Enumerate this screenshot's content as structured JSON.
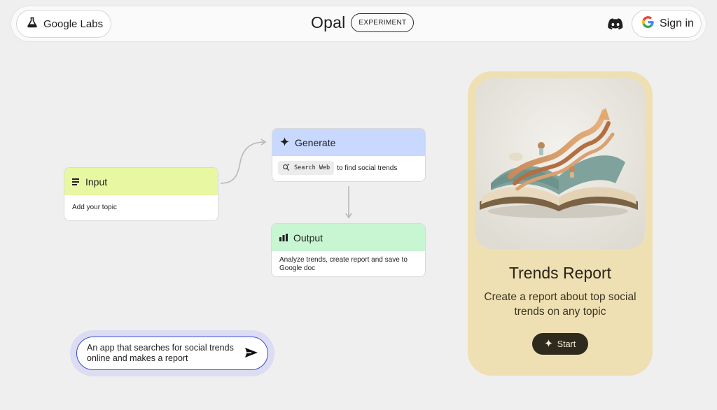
{
  "header": {
    "labs_label": "Google Labs",
    "title": "Opal",
    "badge": "EXPERIMENT",
    "signin_label": "Sign in"
  },
  "icons": {
    "labs": "flask-icon",
    "discord": "discord-icon",
    "signin": "google-g-icon",
    "input": "text-lines-icon",
    "generate": "sparkle-icon",
    "output": "bar-chart-icon",
    "search_chip": "search-sparkle-icon",
    "send": "send-icon",
    "start": "sparkle-icon"
  },
  "flow": {
    "input": {
      "title": "Input",
      "body": "Add your topic"
    },
    "generate": {
      "title": "Generate",
      "chip_label": "Search Web",
      "body": "to find social trends"
    },
    "output": {
      "title": "Output",
      "body": "Analyze trends, create report and save to Google doc"
    }
  },
  "prompt": {
    "text": "An app that searches for social trends online and makes a report"
  },
  "template_card": {
    "title": "Trends Report",
    "description": "Create a report about top social trends on any topic",
    "start_label": "Start"
  },
  "colors": {
    "background": "#efefef",
    "input_header": "#e8f8a2",
    "generate_header": "#c8d8ff",
    "output_header": "#c8f5d2",
    "card_bg": "#efe0b3",
    "start_button": "#2f2a1e",
    "prompt_border": "#3c4bd6"
  }
}
